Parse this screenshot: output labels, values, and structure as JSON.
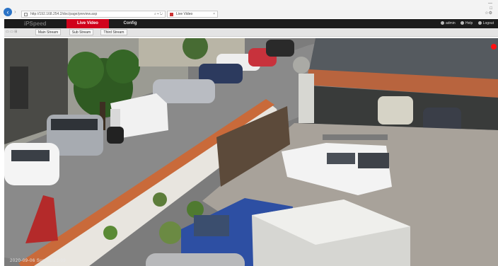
{
  "browser": {
    "url": "http://192.168.254.2/doc/page/preview.asp",
    "tab_title": "Live Video",
    "back_icon": "back-arrow-icon",
    "window_controls": [
      "—",
      "□",
      "☆⚙"
    ]
  },
  "app": {
    "brand": "iPSpeed",
    "nav": {
      "live_video": "Live Video",
      "config": "Config"
    },
    "user": {
      "admin": "admin",
      "help": "Help",
      "logout": "Logout"
    },
    "accent": "#d0021b"
  },
  "toolbar": {
    "main_stream": "Main Stream",
    "sub_stream": "Sub Stream",
    "third_stream": "Third Stream"
  },
  "video": {
    "timestamp": "2020-09-06 Sun 11:21:09"
  }
}
